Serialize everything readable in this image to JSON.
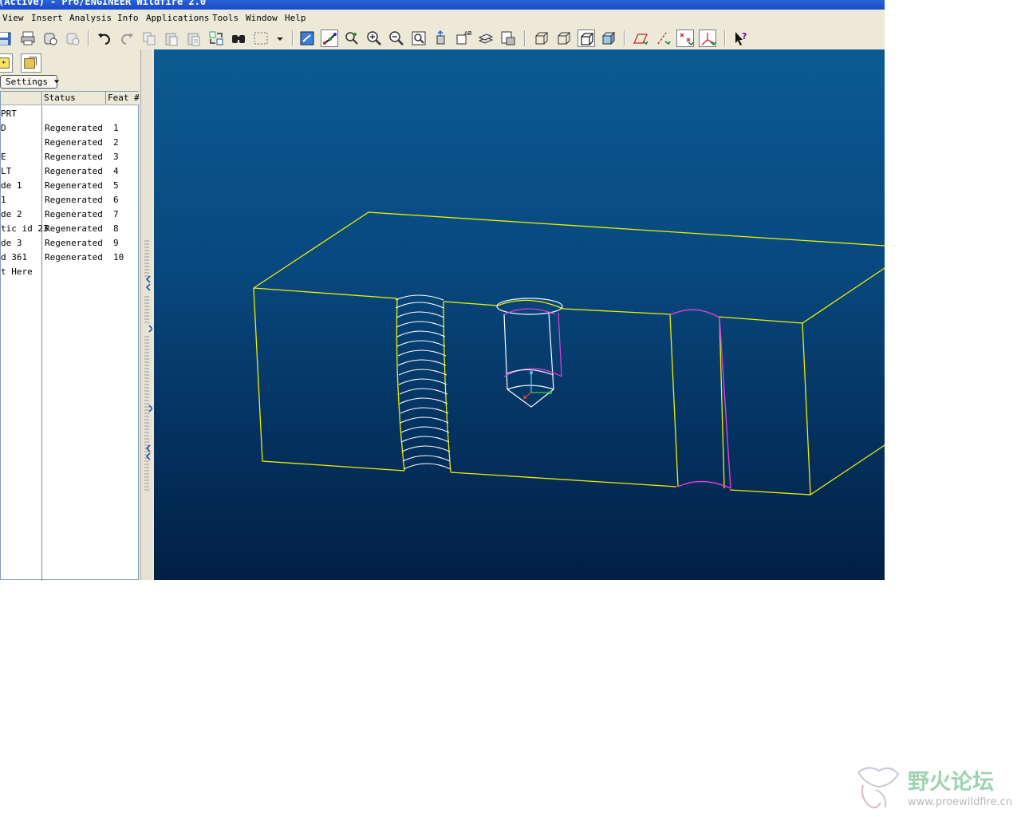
{
  "window": {
    "title": "(Active) - Pro/ENGINEER Wildfire 2.0"
  },
  "menu": {
    "view": "View",
    "insert": "Insert",
    "analysis": "Analysis",
    "info": "Info",
    "applications": "Applications",
    "tools": "Tools",
    "window": "Window",
    "help": "Help"
  },
  "toolbar_icons": [
    "save-icon",
    "print-icon",
    "email-icon",
    "email-link-icon",
    "undo-icon",
    "redo-icon",
    "copy-icon",
    "paste-icon",
    "paste-special-icon",
    "regenerate-icon",
    "find-icon",
    "select-box-icon",
    "dropdown-icon",
    "repaint-icon",
    "spin-center-icon",
    "orient-mode-icon",
    "zoom-in-icon",
    "zoom-out-icon",
    "refit-icon",
    "reorient-icon",
    "saved-views-icon",
    "layers-icon",
    "view-manager-icon",
    "wireframe-icon",
    "hidden-line-icon",
    "no-hidden-icon",
    "shading-icon",
    "datum-planes-icon",
    "datum-axes-icon",
    "datum-points-icon",
    "coordinate-systems-icon",
    "context-help-icon"
  ],
  "model_tree": {
    "settings_label": "Settings",
    "headers": {
      "status": "Status",
      "feat": "Feat #"
    },
    "rows": [
      {
        "name": "PRT",
        "status": "",
        "feat": ""
      },
      {
        "name": "D",
        "status": "Regenerated",
        "feat": "1"
      },
      {
        "name": "",
        "status": "Regenerated",
        "feat": "2"
      },
      {
        "name": "E",
        "status": "Regenerated",
        "feat": "3"
      },
      {
        "name": "LT",
        "status": "Regenerated",
        "feat": "4"
      },
      {
        "name": "de 1",
        "status": "Regenerated",
        "feat": "5"
      },
      {
        "name": "1",
        "status": "Regenerated",
        "feat": "6"
      },
      {
        "name": "de 2",
        "status": "Regenerated",
        "feat": "7"
      },
      {
        "name": "tic id 23",
        "status": "Regenerated",
        "feat": "8"
      },
      {
        "name": "de 3",
        "status": "Regenerated",
        "feat": "9"
      },
      {
        "name": "d 361",
        "status": "Regenerated",
        "feat": "10"
      },
      {
        "name": "t Here",
        "status": "",
        "feat": ""
      }
    ]
  },
  "colors": {
    "edge": "#f0f000",
    "thread": "#ffffff",
    "highlight": "#e040e0",
    "bg_top": "#0c5a93",
    "bg_bottom": "#021f45"
  },
  "watermark": {
    "text": "野火论坛",
    "url": "www.proewildfire.cn"
  }
}
